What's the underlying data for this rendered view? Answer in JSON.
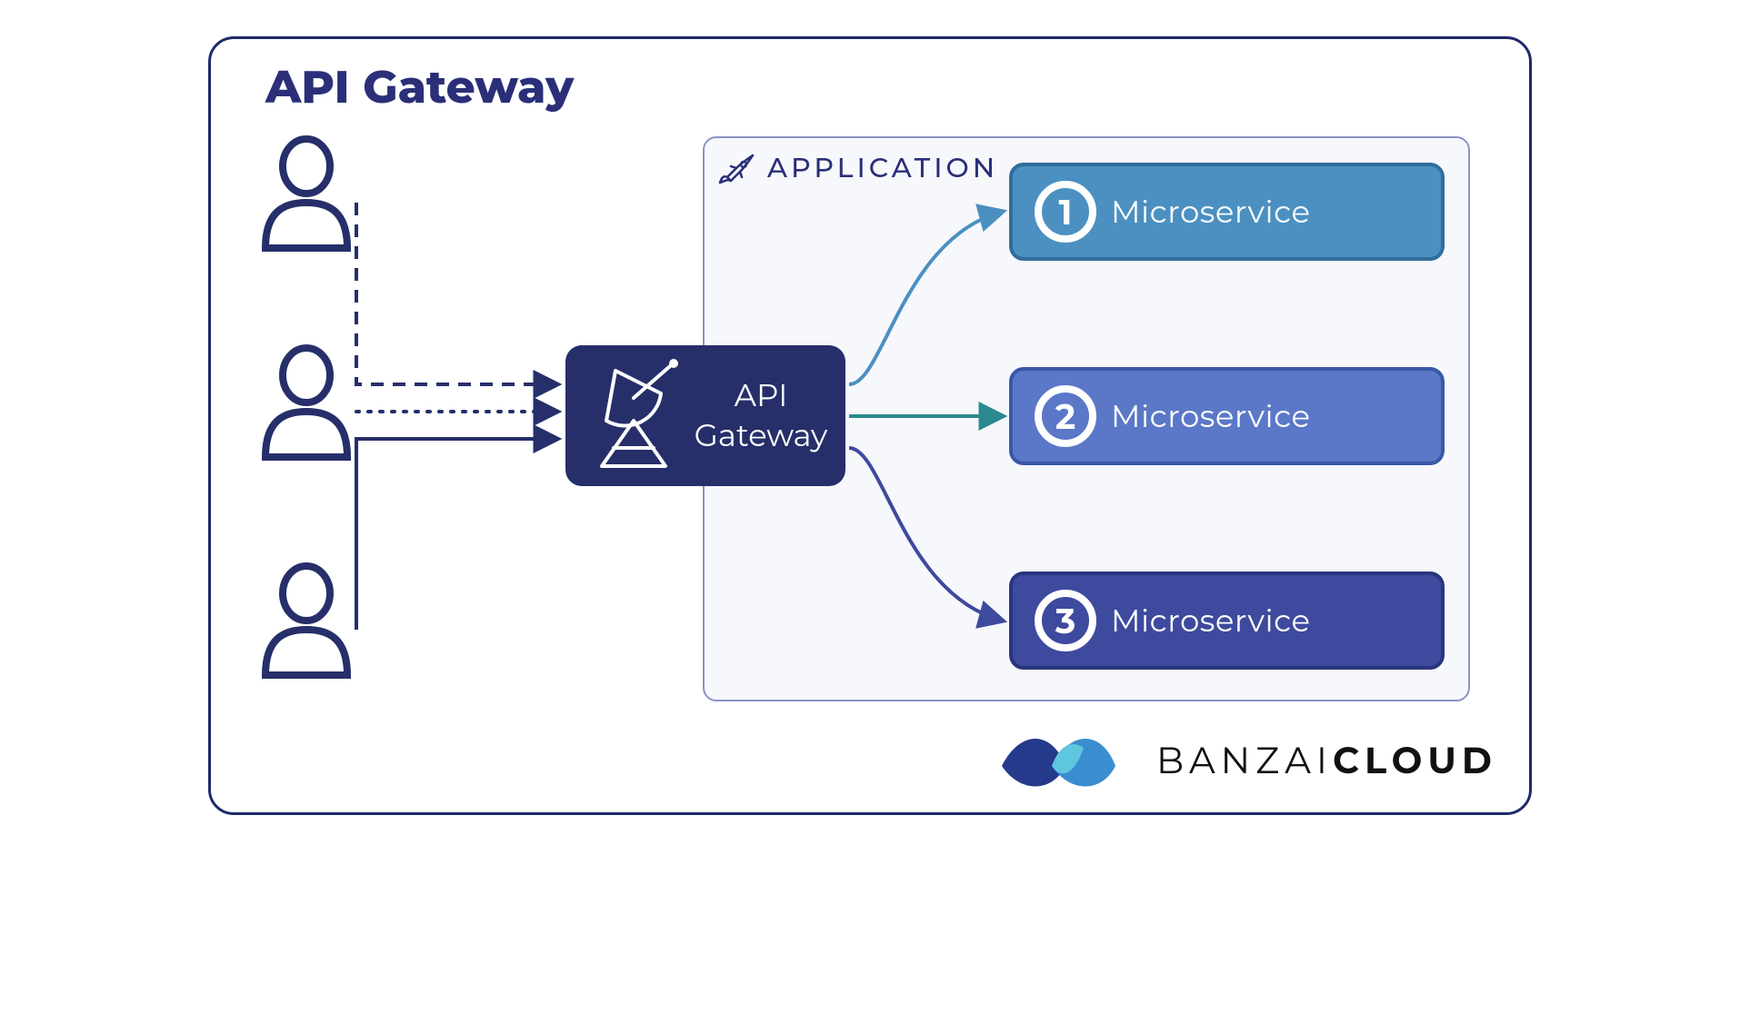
{
  "title": "API Gateway",
  "gateway": {
    "line1": "API",
    "line2": "Gateway"
  },
  "application": {
    "label": "APPLICATION"
  },
  "microservices": [
    {
      "num": "1",
      "label": "Microservice",
      "fill": "#4b90c1",
      "stroke": "#2f6e9d"
    },
    {
      "num": "2",
      "label": "Microservice",
      "fill": "#5a78c7",
      "stroke": "#3a57a8"
    },
    {
      "num": "3",
      "label": "Microservice",
      "fill": "#3e4a9e",
      "stroke": "#2a357f"
    }
  ],
  "users": [
    {
      "arrowStyle": "dashed"
    },
    {
      "arrowStyle": "dotted"
    },
    {
      "arrowStyle": "solid"
    }
  ],
  "branding": {
    "text1": "BANZAI",
    "text2": "CLOUD"
  },
  "colors": {
    "navy": "#262f6a",
    "outline": "#1f2a6b",
    "teal": "#2b8a8f",
    "appBg": "#f7f8fc",
    "appBorder": "#8a93c7"
  }
}
